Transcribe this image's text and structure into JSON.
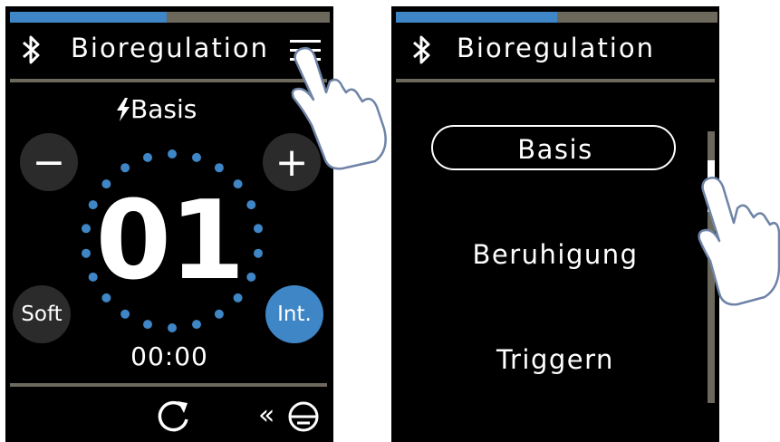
{
  "colors": {
    "accent": "#3f86c6",
    "track": "#6d685c",
    "button": "#2b2b2b",
    "background": "#000000",
    "hand_stroke": "#6e83a6"
  },
  "left_screen": {
    "progress": 0.49,
    "header": {
      "title": "Bioregulation",
      "bluetooth_icon": "bluetooth-icon",
      "menu_icon": "hamburger-menu-icon"
    },
    "mode": {
      "icon": "lightning-icon",
      "label": "Basis"
    },
    "minus_label": "−",
    "plus_label": "+",
    "level": "01",
    "soft_label": "Soft",
    "intensity_label": "Int.",
    "timer": "00:00",
    "footer": {
      "reset_icon": "refresh-icon",
      "back_label": "«",
      "device_icon": "electrode-icon"
    }
  },
  "right_screen": {
    "progress": 0.5,
    "header": {
      "title": "Bioregulation",
      "bluetooth_icon": "bluetooth-icon"
    },
    "menu": [
      {
        "label": "Basis",
        "selected": true
      },
      {
        "label": "Beruhigung",
        "selected": false
      },
      {
        "label": "Triggern",
        "selected": false
      }
    ],
    "scroll_position": 0.13
  },
  "gesture_icons": [
    "tap-hand-icon",
    "swipe-hand-icon"
  ]
}
